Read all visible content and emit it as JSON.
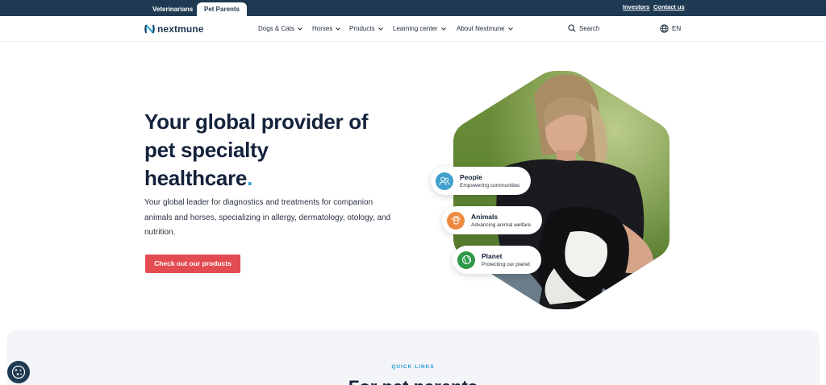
{
  "topbar": {
    "tabs": [
      {
        "label": "Veterinarians",
        "active": false
      },
      {
        "label": "Pet Parents",
        "active": true
      }
    ],
    "links": [
      "Investors",
      "Contact us"
    ]
  },
  "nav": {
    "logo_text": "nextmune",
    "items": [
      {
        "label": "Dogs & Cats"
      },
      {
        "label": "Horses"
      },
      {
        "label": "Products"
      },
      {
        "label": "Learning center"
      },
      {
        "label": "About Nextmune"
      }
    ],
    "search_label": "Search",
    "language": "EN"
  },
  "hero": {
    "title_line1": "Your global provider of",
    "title_line2": "pet specialty",
    "title_line3": "healthcare",
    "title_dot": ".",
    "subtitle": "Your global leader for diagnostics and treatments for companion animals and horses, specializing in allergy, dermatology, otology, and nutrition.",
    "cta": "Check out our products"
  },
  "pillars": [
    {
      "title": "People",
      "desc": "Empowering communities",
      "icon": "people-icon",
      "color": "#3fa0cc"
    },
    {
      "title": "Animals",
      "desc": "Advancing animal welfare",
      "icon": "paw-icon",
      "color": "#ec8a3f"
    },
    {
      "title": "Planet",
      "desc": "Protecting our planet",
      "icon": "globe-icon",
      "color": "#2e9a47"
    }
  ],
  "quick_links": {
    "label": "QUICK LINKS",
    "heading": "For pet parents"
  },
  "colors": {
    "navy": "#1e3a52",
    "accent_red": "#e24b4f",
    "accent_blue": "#2b9ed4"
  }
}
